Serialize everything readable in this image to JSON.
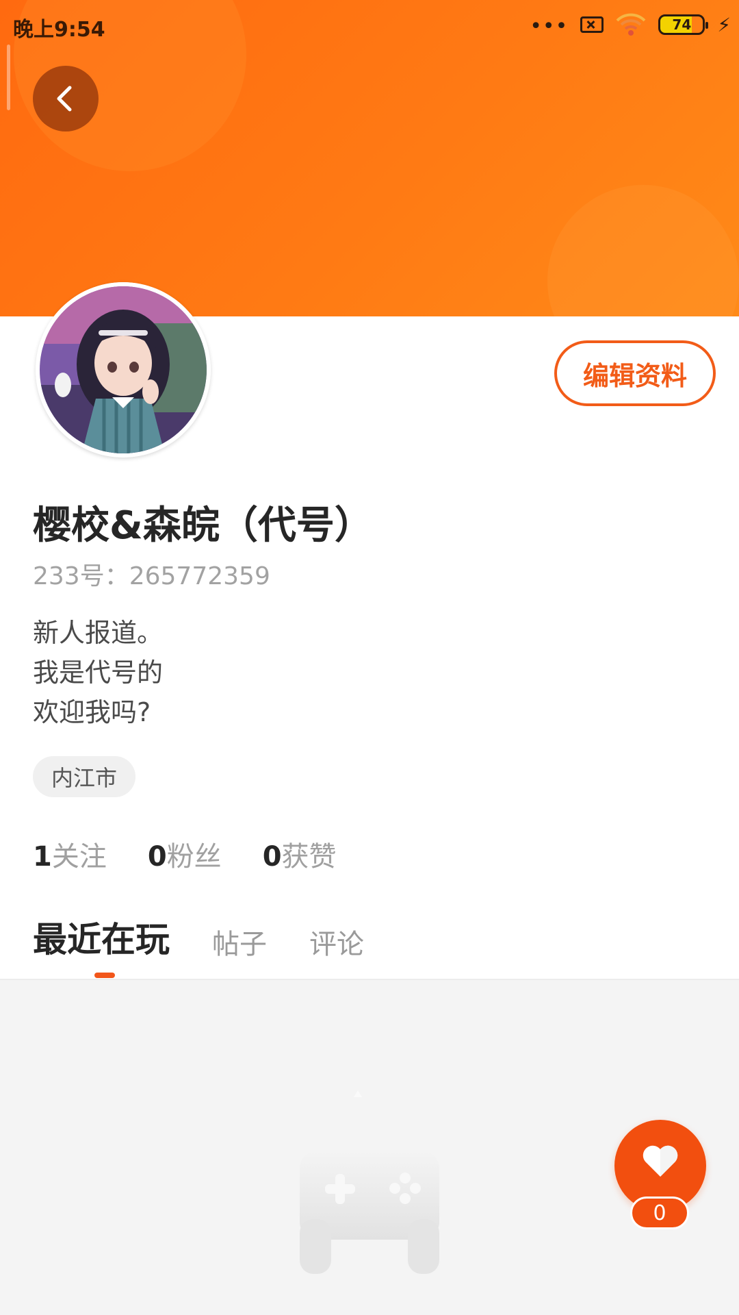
{
  "status_bar": {
    "time": "晚上9:54",
    "dots": "•••",
    "battery": "74",
    "bolt": "⚡"
  },
  "profile": {
    "edit_button": "编辑资料",
    "nickname": "樱校&森皖（代号）",
    "uid": "233号：265772359",
    "bio_lines": [
      "新人报道。",
      "我是代号的",
      "欢迎我吗?"
    ],
    "location": "内江市"
  },
  "stats": [
    {
      "num": "1",
      "label": "关注"
    },
    {
      "num": "0",
      "label": "粉丝"
    },
    {
      "num": "0",
      "label": "获赞"
    }
  ],
  "tabs": [
    {
      "label": "最近在玩",
      "active": true
    },
    {
      "label": "帖子",
      "active": false
    },
    {
      "label": "评论",
      "active": false
    }
  ],
  "like": {
    "count": "0"
  },
  "colors": {
    "accent": "#f2561a",
    "banner_start": "#ff6a10",
    "banner_end": "#ff8a18",
    "content_bg": "#f4f4f4"
  },
  "icons": {
    "back": "back-arrow-icon",
    "like": "heart-icon",
    "empty": "gamepad-icon"
  }
}
